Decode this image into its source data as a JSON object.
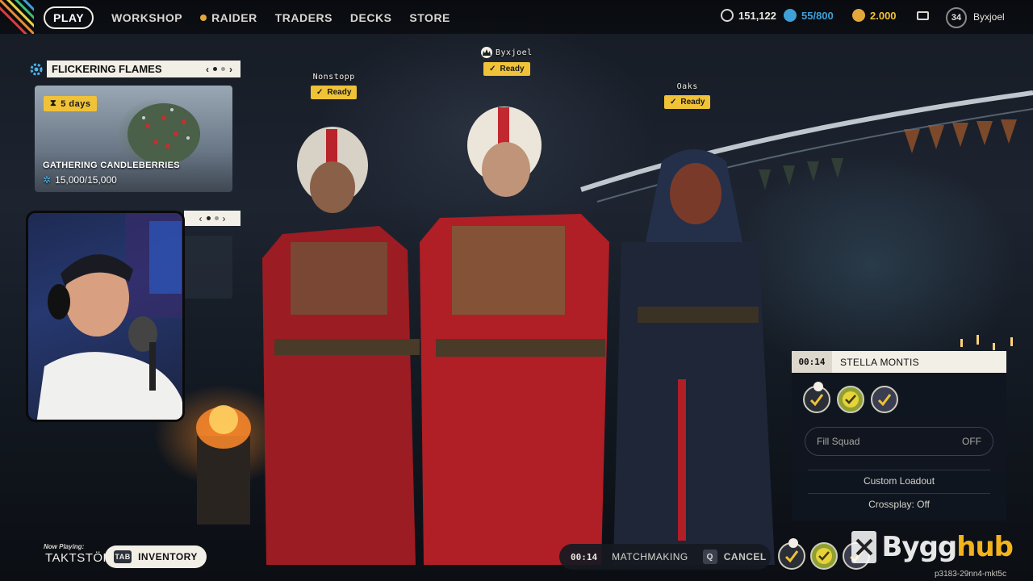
{
  "nav": {
    "items": [
      {
        "label": "PLAY",
        "active": true
      },
      {
        "label": "WORKSHOP",
        "active": false
      },
      {
        "label": "RAIDER",
        "active": false
      },
      {
        "label": "TRADERS",
        "active": false
      },
      {
        "label": "DECKS",
        "active": false
      },
      {
        "label": "STORE",
        "active": false
      }
    ]
  },
  "currencies": {
    "credits": "151,122",
    "tokens": "55/800",
    "coins": "2.000"
  },
  "profile": {
    "level": "34",
    "username": "Byxjoel"
  },
  "event": {
    "title": "FLICKERING FLAMES",
    "timer": "5 days",
    "card_title": "GATHERING CANDLEBERRIES",
    "progress": "15,000/15,000"
  },
  "players": [
    {
      "name": "Nonstopp",
      "status": "Ready",
      "leader": false
    },
    {
      "name": "Byxjoel",
      "status": "Ready",
      "leader": true
    },
    {
      "name": "Oaks",
      "status": "Ready",
      "leader": false
    }
  ],
  "squad": {
    "timer": "00:14",
    "location": "STELLA MONTIS",
    "fill_squad_label": "Fill Squad",
    "fill_squad_value": "OFF",
    "custom_loadout_label": "Custom Loadout",
    "crossplay_label": "Crossplay: Off"
  },
  "matchmaking": {
    "timer": "00:14",
    "label": "MATCHMAKING",
    "cancel_key": "Q",
    "cancel_label": "CANCEL"
  },
  "inventory": {
    "key": "TAB",
    "label": "INVENTORY"
  },
  "now_playing": {
    "label": "Now Playing:",
    "track": "TAKTSTÖRER, Arm"
  },
  "watermark": {
    "part1": "Bygg",
    "part2": "hub"
  },
  "build_id": "p3183-29nn4-mkt5c",
  "colors": {
    "accent_yellow": "#f0c238",
    "panel_light": "#f2efe6",
    "token_blue": "#3fa0d8",
    "coin_gold": "#e2a83a"
  }
}
